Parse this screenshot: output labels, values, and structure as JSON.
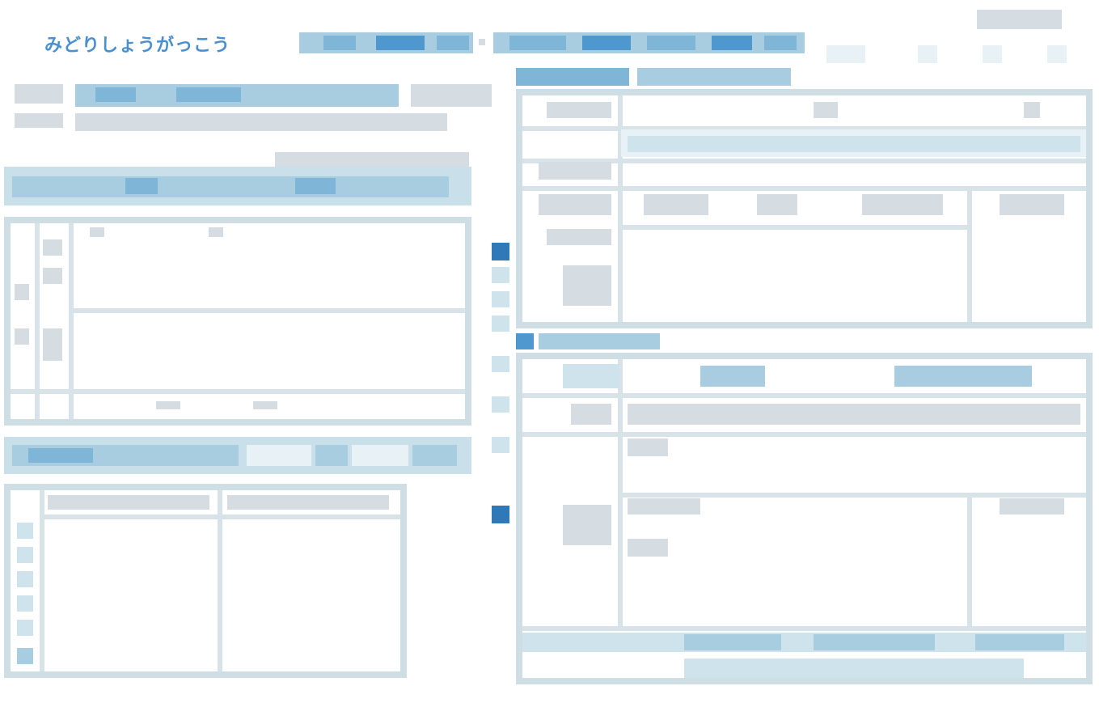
{
  "header": {
    "school_name": "みどりしょうがっこう"
  },
  "colors": {
    "accent": "#4a90cf",
    "border": "#cfdde4",
    "header_fill": "#c9dfe9",
    "cell_fill": "#a9cde0",
    "marker": "#2f79b9"
  }
}
